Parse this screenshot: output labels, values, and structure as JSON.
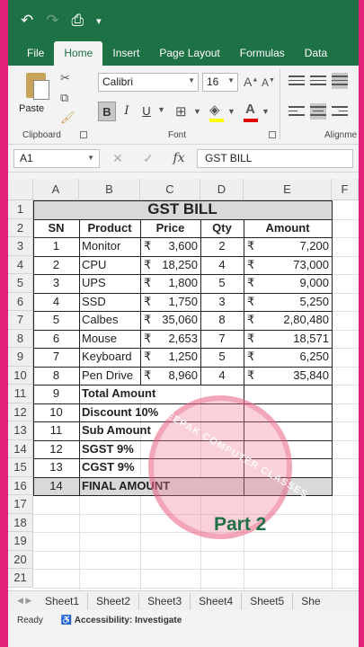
{
  "quick_access": {
    "undo_icon": "↶",
    "redo_icon": "↷",
    "preview_icon": "⎙",
    "more_icon": "▾"
  },
  "tabs": [
    "File",
    "Home",
    "Insert",
    "Page Layout",
    "Formulas",
    "Data"
  ],
  "ribbon": {
    "clipboard": {
      "paste_label": "Paste",
      "group_label": "Clipboard"
    },
    "font": {
      "name": "Calibri",
      "size": "16",
      "group_label": "Font",
      "bold": "B",
      "italic": "I",
      "underline": "U"
    },
    "alignment": {
      "group_label": "Alignme"
    }
  },
  "formula_bar": {
    "name_box": "A1",
    "cancel_icon": "✕",
    "enter_icon": "✓",
    "fx_label": "fx",
    "content": "GST BILL"
  },
  "grid": {
    "columns": [
      "A",
      "B",
      "C",
      "D",
      "E",
      "F"
    ],
    "rows": [
      "1",
      "2",
      "3",
      "4",
      "5",
      "6",
      "7",
      "8",
      "9",
      "10",
      "11",
      "12",
      "13",
      "14",
      "15",
      "16",
      "17",
      "18",
      "19",
      "20",
      "21"
    ],
    "title": "GST BILL",
    "headers": {
      "sn": "SN",
      "product": "Product",
      "price": "Price",
      "qty": "Qty",
      "amount": "Amount"
    },
    "currency": "₹",
    "items": [
      {
        "sn": "1",
        "product": "Monitor",
        "price": "3,600",
        "qty": "2",
        "amount": "7,200"
      },
      {
        "sn": "2",
        "product": "CPU",
        "price": "18,250",
        "qty": "4",
        "amount": "73,000"
      },
      {
        "sn": "3",
        "product": "UPS",
        "price": "1,800",
        "qty": "5",
        "amount": "9,000"
      },
      {
        "sn": "4",
        "product": "SSD",
        "price": "1,750",
        "qty": "3",
        "amount": "5,250"
      },
      {
        "sn": "5",
        "product": "Calbes",
        "price": "35,060",
        "qty": "8",
        "amount": "2,80,480"
      },
      {
        "sn": "6",
        "product": "Mouse",
        "price": "2,653",
        "qty": "7",
        "amount": "18,571"
      },
      {
        "sn": "7",
        "product": "Keyboard",
        "price": "1,250",
        "qty": "5",
        "amount": "6,250"
      },
      {
        "sn": "8",
        "product": "Pen Drive",
        "price": "8,960",
        "qty": "4",
        "amount": "35,840"
      }
    ],
    "summary": [
      {
        "sn": "9",
        "label": "Total Amount"
      },
      {
        "sn": "10",
        "label": "Discount 10%"
      },
      {
        "sn": "11",
        "label": "Sub Amount"
      },
      {
        "sn": "12",
        "label": "SGST 9%"
      },
      {
        "sn": "13",
        "label": "CGST 9%"
      },
      {
        "sn": "14",
        "label": "FINAL AMOUNT"
      }
    ]
  },
  "watermark": {
    "text": "DEEPAK COMPUTER CLASSES",
    "part": "Part 2"
  },
  "sheet_tabs": [
    "Sheet1",
    "Sheet2",
    "Sheet3",
    "Sheet4",
    "Sheet5",
    "She"
  ],
  "status": {
    "ready": "Ready",
    "accessibility": "Accessibility: Investigate"
  }
}
